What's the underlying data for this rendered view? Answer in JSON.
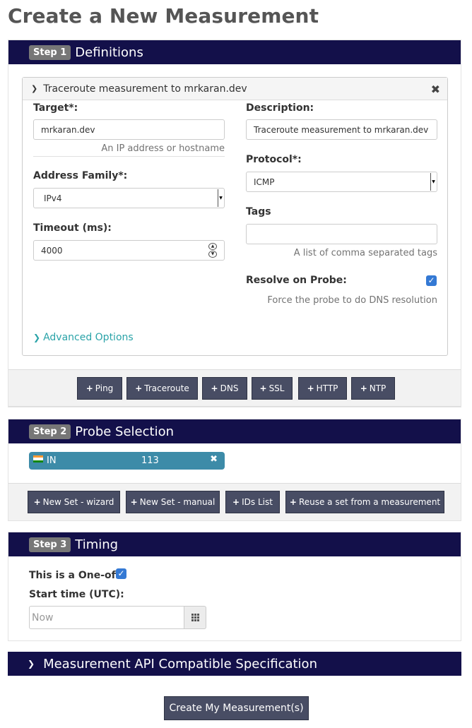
{
  "page": {
    "title": "Create a New Measurement"
  },
  "step1": {
    "badge": "Step 1",
    "title": "Definitions",
    "panel": {
      "header": "Traceroute measurement to mrkaran.dev",
      "target_label": "Target*:",
      "target_value": "mrkaran.dev",
      "target_help": "An IP address or hostname",
      "description_label": "Description:",
      "description_value": "Traceroute measurement to mrkaran.dev",
      "address_family_label": "Address Family*:",
      "address_family_value": "IPv4",
      "protocol_label": "Protocol*:",
      "protocol_value": "ICMP",
      "tags_label": "Tags",
      "tags_value": "",
      "tags_help": "A list of comma separated tags",
      "timeout_label": "Timeout (ms):",
      "timeout_value": "4000",
      "resolve_label": "Resolve on Probe:",
      "resolve_checked": true,
      "resolve_help": "Force the probe to do DNS resolution",
      "advanced_label": "Advanced Options"
    },
    "add_buttons": [
      "Ping",
      "Traceroute",
      "DNS",
      "SSL",
      "HTTP",
      "NTP"
    ]
  },
  "step2": {
    "badge": "Step 2",
    "title": "Probe Selection",
    "probe": {
      "country": "IN",
      "count": "113"
    },
    "buttons": [
      "New Set - wizard",
      "New Set - manual",
      "IDs List",
      "Reuse a set from a measurement"
    ]
  },
  "step3": {
    "badge": "Step 3",
    "title": "Timing",
    "oneoff_label": "This is a One-off:",
    "oneoff_checked": true,
    "start_label": "Start time (UTC):",
    "start_placeholder": "Now"
  },
  "api_spec": {
    "title": "Measurement API Compatible Specification"
  },
  "submit": {
    "label": "Create My Measurement(s)"
  },
  "colors": {
    "header_bg": "#13104a",
    "button_bg": "#484d64",
    "link": "#2aa3a8",
    "checkbox": "#3479d4",
    "probe_chip": "#3d8ba8"
  },
  "icons": {
    "collapse": "chevron-down-icon",
    "close": "close-icon",
    "expand": "chevron-right-icon",
    "plus": "plus-icon",
    "calendar": "calendar-grid-icon",
    "flag": "flag-india-icon"
  }
}
